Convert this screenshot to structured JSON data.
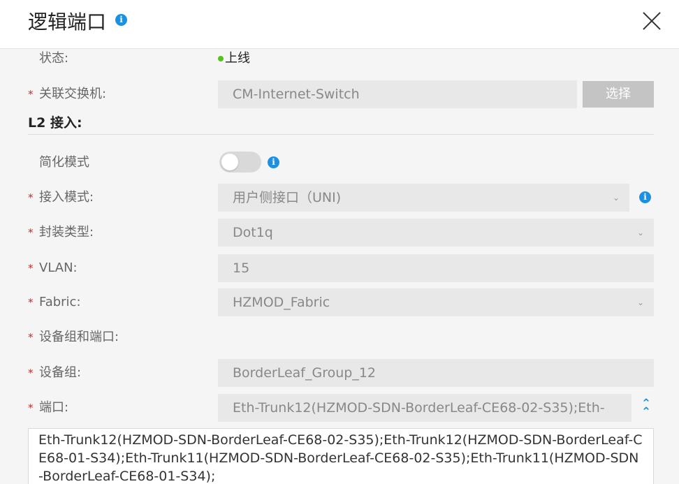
{
  "dialog": {
    "title": "逻辑端口",
    "info_icon": "info-icon",
    "close_icon": "close-icon"
  },
  "status": {
    "label": "状态:",
    "value": "上线",
    "dot_color": "#52c41a"
  },
  "switch": {
    "label": "关联交换机:",
    "value": "CM-Internet-Switch",
    "button_label": "选择"
  },
  "section": {
    "title": "L2 接入:"
  },
  "simplified": {
    "label": "简化模式",
    "enabled": false
  },
  "access_mode": {
    "label": "接入模式:",
    "value": "用户侧接口（UNI)"
  },
  "encapsulation": {
    "label": "封装类型:",
    "value": "Dot1q"
  },
  "vlan": {
    "label": "VLAN:",
    "value": "15"
  },
  "fabric": {
    "label": "Fabric:",
    "value": "HZMOD_Fabric"
  },
  "device_group_port": {
    "label": "设备组和端口:"
  },
  "device_group": {
    "label": "设备组:",
    "value": "BorderLeaf_Group_12"
  },
  "port": {
    "label": "端口:",
    "value": "Eth-Trunk12(HZMOD-SDN-BorderLeaf-CE68-02-S35);Eth-",
    "detail": "Eth-Trunk12(HZMOD-SDN-BorderLeaf-CE68-02-S35);Eth-Trunk12(HZMOD-SDN-BorderLeaf-CE68-01-S34);Eth-Trunk11(HZMOD-SDN-BorderLeaf-CE68-02-S35);Eth-Trunk11(HZMOD-SDN-BorderLeaf-CE68-01-S34);"
  },
  "required_mark": "*",
  "colors": {
    "accent": "#1e90e0",
    "required": "#e02020"
  }
}
